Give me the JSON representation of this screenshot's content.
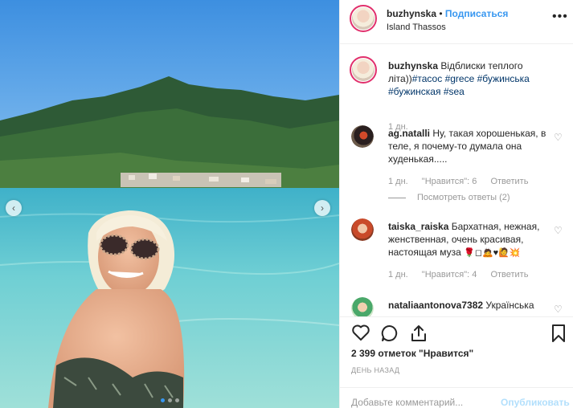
{
  "post": {
    "username": "buzhynska",
    "separator": "•",
    "follow_label": "Подписаться",
    "location": "Island Thassos",
    "more_icon": "more-icon"
  },
  "caption": {
    "username": "buzhynska",
    "text": "Відблиски теплого літа))",
    "hashtags": [
      "#тасос",
      "#grece",
      "#бужинська",
      "#бужинская",
      "#sea"
    ],
    "time": "1 дн."
  },
  "comments": [
    {
      "username": "ag.natalli",
      "text": "Ну, такая хорошенькая, в теле, я почему-то думала она худенькая.....",
      "time": "1 дн.",
      "likes": "\"Нравится\": 6",
      "reply": "Ответить",
      "view_replies": "Посмотреть ответы (2)"
    },
    {
      "username": "taiska_raiska",
      "text": "Бархатная, нежная, женственная, очень красивая, настоящая муза",
      "emojis": "🌹◻🙇♥🙋💥",
      "time": "1 дн.",
      "likes": "\"Нравится\": 4",
      "reply": "Ответить"
    },
    {
      "username": "nataliaantonova7382",
      "text": "Українська"
    }
  ],
  "likes_text": "2 399 отметок \"Нравится\"",
  "posted": "ДЕНЬ НАЗАД",
  "add_comment": {
    "placeholder": "Добавьте комментарий...",
    "publish_label": "Опубликовать"
  },
  "colors": {
    "link": "#3897f0",
    "hashtag": "#003569",
    "muted": "#999999",
    "ring": "#e1306c"
  }
}
